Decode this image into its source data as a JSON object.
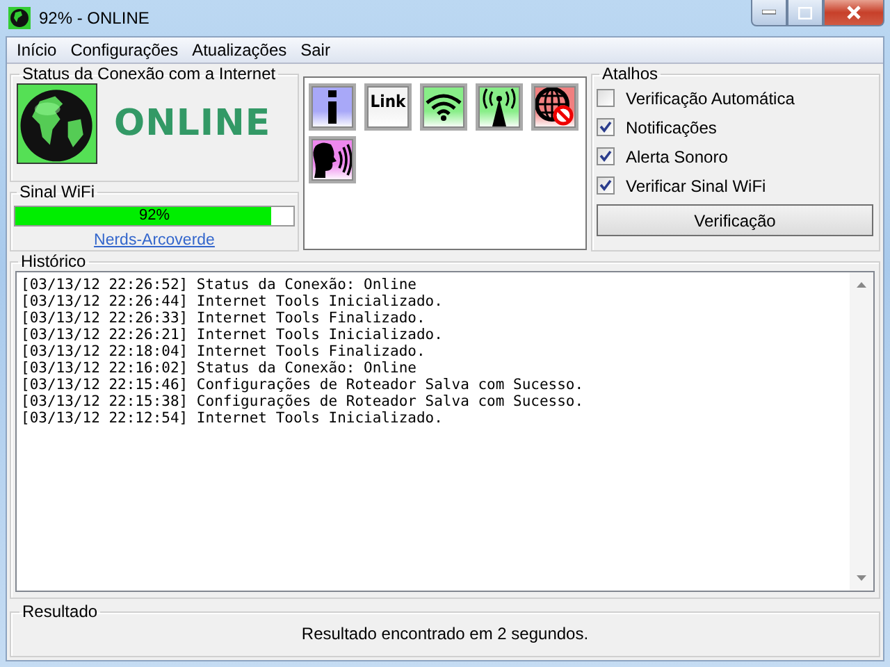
{
  "window": {
    "title": "92% - ONLINE"
  },
  "menu": [
    {
      "label": "Início"
    },
    {
      "label": "Configurações"
    },
    {
      "label": "Atualizações"
    },
    {
      "label": "Sair"
    }
  ],
  "status": {
    "title": "Status da Conexão com a Internet",
    "state": "ONLINE"
  },
  "wifi": {
    "title": "Sinal WiFi",
    "level": 0.92,
    "reading": "92%",
    "network": "Nerds-Arcoverde"
  },
  "tools": [
    {
      "kind": "info",
      "color": "#a8a8f8"
    },
    {
      "kind": "link",
      "label": "Link",
      "color": "#f4f4f4"
    },
    {
      "kind": "wifi",
      "color": "#88ee88"
    },
    {
      "kind": "antenna",
      "color": "#88ee88"
    },
    {
      "kind": "globe-blocked",
      "color": "#f08080"
    },
    {
      "kind": "speech",
      "color": "#ee88ee"
    }
  ],
  "shortcuts": {
    "title": "Atalhos",
    "options": [
      {
        "label": "Verificação Automática",
        "checked": false
      },
      {
        "label": "Notificações",
        "checked": true
      },
      {
        "label": "Alerta Sonoro",
        "checked": true
      },
      {
        "label": "Verificar Sinal WiFi",
        "checked": true
      }
    ],
    "button": "Verificação"
  },
  "history": {
    "title": "Histórico",
    "lines": [
      "[03/13/12 22:26:52] Status da Conexão: Online",
      "[03/13/12 22:26:44] Internet Tools Inicializado.",
      "[03/13/12 22:26:33] Internet Tools Finalizado.",
      "[03/13/12 22:26:21] Internet Tools Inicializado.",
      "[03/13/12 22:18:04] Internet Tools Finalizado.",
      "[03/13/12 22:16:02] Status da Conexão: Online",
      "[03/13/12 22:15:46] Configurações de Roteador Salva com Sucesso.",
      "[03/13/12 22:15:38] Configurações de Roteador Salva com Sucesso.",
      "[03/13/12 22:12:54] Internet Tools Inicializado."
    ]
  },
  "result": {
    "title": "Resultado",
    "text": "Resultado encontrado em 2 segundos."
  }
}
